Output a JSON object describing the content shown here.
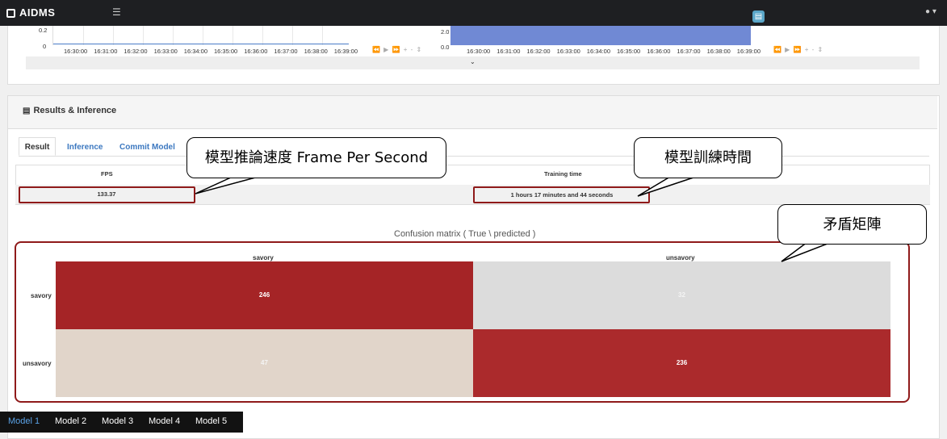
{
  "app": {
    "title": "AIDMS"
  },
  "header": {
    "menu_icon": "hamburger-icon",
    "notes_icon": "notes-icon",
    "user_icon": "user-icon"
  },
  "top_charts": {
    "line_chart": {
      "y_ticks": [
        "0.2",
        "0"
      ],
      "x_ticks": [
        "16:30:00",
        "16:31:00",
        "16:32:00",
        "16:33:00",
        "16:34:00",
        "16:35:00",
        "16:36:00",
        "16:37:00",
        "16:38:00",
        "16:39:00"
      ]
    },
    "bar_chart": {
      "y_ticks": [
        "2.0",
        "0.0"
      ],
      "x_ticks": [
        "16:30:00",
        "16:31:00",
        "16:32:00",
        "16:33:00",
        "16:34:00",
        "16:35:00",
        "16:36:00",
        "16:37:00",
        "16:38:00",
        "16:39:00"
      ]
    },
    "nav_controls": "⏪ ▶ ⏩ + - ⇕",
    "expand_icon": "⌄"
  },
  "results": {
    "title": "Results & Inference",
    "tabs": [
      "Result",
      "Inference",
      "Commit Model"
    ],
    "metrics": {
      "fps_label": "FPS",
      "fps_value": "133.37",
      "training_time_label": "Training time",
      "training_time_value": "1 hours 17 minutes and 44 seconds"
    },
    "confusion_matrix": {
      "title": "Confusion matrix ( True \\ predicted )",
      "columns": [
        "savory",
        "unsavory"
      ],
      "rows": [
        {
          "label": "savory",
          "values": [
            "246",
            "32"
          ]
        },
        {
          "label": "unsavory",
          "values": [
            "47",
            "236"
          ]
        }
      ]
    }
  },
  "callouts": {
    "fps": "模型推論速度 Frame Per Second",
    "training_time": "模型訓練時間",
    "confusion": "矛盾矩陣"
  },
  "colors": {
    "accent": "#3c78c0",
    "highlight": "#8f1a1a",
    "cell_high": "#a52426",
    "cell_low_light": "#dcdcdc",
    "cell_low_tan": "#e1d5ca",
    "bar": "#7089d4"
  },
  "model_tabs": [
    "Model 1",
    "Model 2",
    "Model 3",
    "Model 4",
    "Model 5"
  ]
}
